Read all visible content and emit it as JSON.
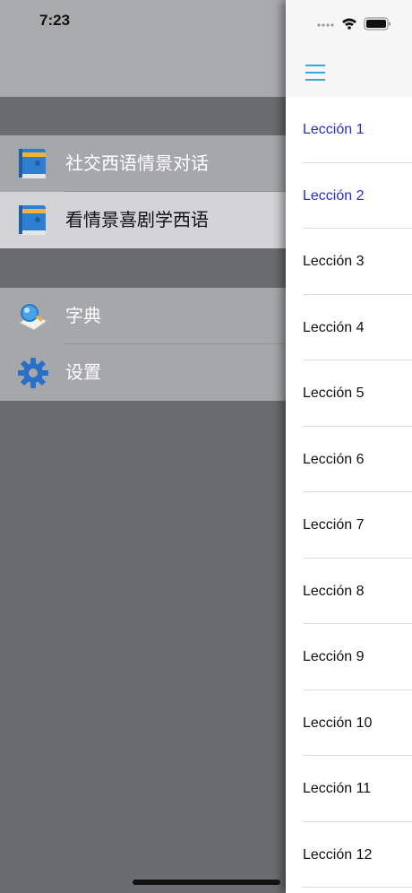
{
  "status": {
    "time": "7:23"
  },
  "drawer": {
    "group1": [
      {
        "label": "社交西语情景对话",
        "icon": "book-icon",
        "selected": false
      },
      {
        "label": "看情景喜剧学西语",
        "icon": "book-icon",
        "selected": true
      }
    ],
    "group2": [
      {
        "label": "字典",
        "icon": "dictionary-icon"
      },
      {
        "label": "设置",
        "icon": "gear-icon"
      }
    ]
  },
  "panel": {
    "menu_icon": "hamburger-icon",
    "lessons": [
      "Lección 1",
      "Lección 2",
      "Lección 3",
      "Lección 4",
      "Lección 5",
      "Lección 6",
      "Lección 7",
      "Lección 8",
      "Lección 9",
      "Lección 10",
      "Lección 11",
      "Lección 12"
    ],
    "highlight_color": "#2b2bd0",
    "accent_color": "#3aa6e0"
  }
}
